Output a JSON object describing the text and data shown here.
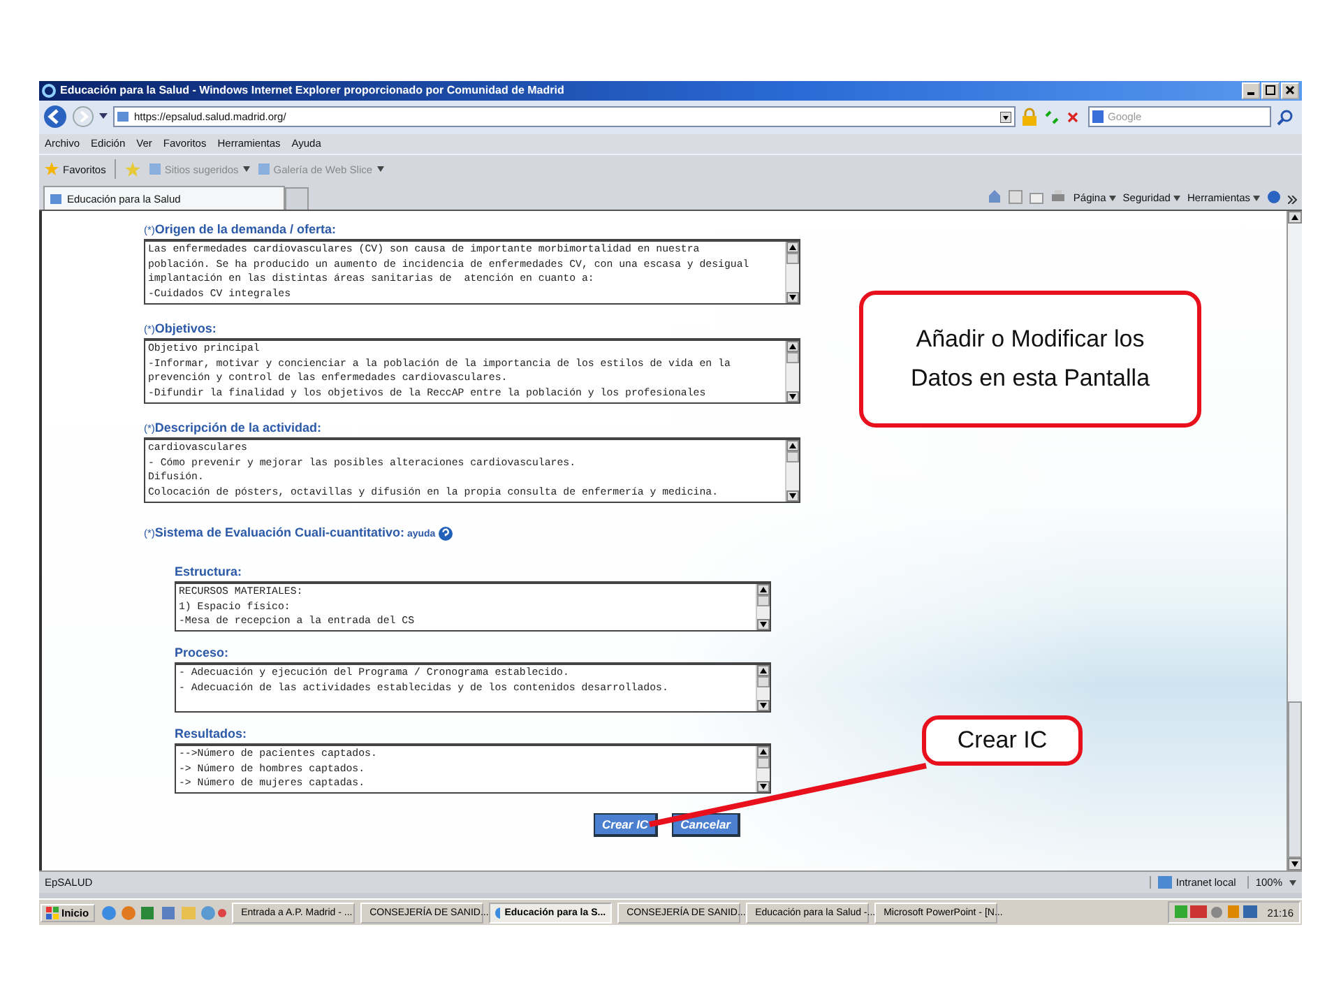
{
  "window": {
    "title": "Educación para la Salud - Windows Internet Explorer proporcionado por Comunidad de Madrid"
  },
  "address_bar": {
    "url": "https://epsalud.salud.madrid.org/"
  },
  "search": {
    "placeholder": "Google"
  },
  "menu": [
    "Archivo",
    "Edición",
    "Ver",
    "Favoritos",
    "Herramientas",
    "Ayuda"
  ],
  "favorites_bar": {
    "favorites": "Favoritos",
    "links": [
      "Sitios sugeridos",
      "Galería de Web Slice"
    ]
  },
  "tab": {
    "title": "Educación para la Salud"
  },
  "command_bar": [
    "Página",
    "Seguridad",
    "Herramientas"
  ],
  "form": {
    "fields": [
      {
        "required_mark": "(*)",
        "label": "Origen de la demanda / oferta:",
        "lines": [
          "Las enfermedades cardiovasculares (CV) son causa de importante morbimortalidad en nuestra",
          "población. Se ha producido un aumento de incidencia de enfermedades CV, con una escasa y desigual",
          "implantación en las distintas áreas sanitarias de  atención en cuanto a:",
          "-Cuidados CV integrales"
        ]
      },
      {
        "required_mark": "(*)",
        "label": "Objetivos:",
        "lines": [
          "Objetivo principal",
          "-Informar, motivar y concienciar a la población de la importancia de los estilos de vida en la",
          "prevención y control de las enfermedades cardiovasculares.",
          "-Difundir la finalidad y los objetivos de la ReccAP entre la población y los profesionales"
        ]
      },
      {
        "required_mark": "(*)",
        "label": "Descripción de la actividad:",
        "lines": [
          "cardiovasculares",
          "- Cómo prevenir y mejorar las posibles alteraciones cardiovasculares.",
          "Difusión.",
          "Colocación de pósters, octavillas y difusión en la propia consulta de enfermería y medicina."
        ]
      }
    ],
    "evaluation": {
      "required_mark": "(*)",
      "label": "Sistema de Evaluación Cuali-cuantitativo:",
      "help": "ayuda",
      "subfields": [
        {
          "label": "Estructura:",
          "lines": [
            "RECURSOS MATERIALES:",
            "1) Espacio físico:",
            "-Mesa de recepcion a la entrada del CS"
          ]
        },
        {
          "label": "Proceso:",
          "lines": [
            "- Adecuación y ejecución del Programa / Cronograma establecido.",
            "- Adecuación de las actividades establecidas y de los contenidos desarrollados."
          ]
        },
        {
          "label": "Resultados:",
          "lines": [
            "-->Número de pacientes captados.",
            "-> Número de hombres captados.",
            "-> Número de mujeres captadas."
          ]
        }
      ]
    },
    "buttons": [
      "Crear IC",
      "Cancelar"
    ]
  },
  "status_bar": {
    "text": "EpSALUD",
    "zone": "Intranet local",
    "zoom": "100%"
  },
  "taskbar": {
    "start": "Inicio",
    "tasks": [
      {
        "label": "Entrada a A.P. Madrid - ...",
        "selected": false
      },
      {
        "label": "CONSEJERÍA DE SANID...",
        "selected": false
      },
      {
        "label": "Educación para la S...",
        "selected": true
      },
      {
        "label": "CONSEJERÍA DE SANID...",
        "selected": false
      },
      {
        "label": "Educación para la Salud -...",
        "selected": false
      },
      {
        "label": "Microsoft PowerPoint - [N...",
        "selected": false
      }
    ],
    "clock": "21:16"
  },
  "callouts": [
    {
      "kind": "box",
      "text": "Añadir o Modificar los Datos en esta Pantalla"
    },
    {
      "kind": "pointer",
      "text": "Crear IC"
    }
  ]
}
